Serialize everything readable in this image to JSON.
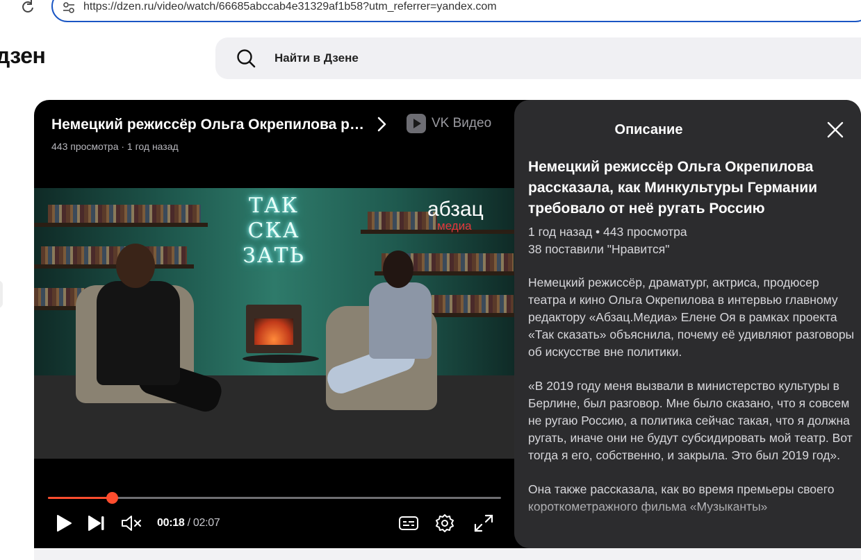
{
  "browser": {
    "url": "https://dzen.ru/video/watch/66685abccab4e31329af1b58?utm_referrer=yandex.com"
  },
  "header": {
    "logo": "дзен",
    "search_placeholder": "Найти в Дзене"
  },
  "player": {
    "title": "Немецкий режиссёр Ольга Окрепилова рассказала, как Минкультуры Германии требовало от неё ругать Россию",
    "meta": "443 просмотра · 1 год назад",
    "platform": "VK Видео",
    "video": {
      "neon_lines": [
        "ТАК",
        "СКА",
        "ЗАТЬ"
      ],
      "brand_main": "абзац",
      "brand_sub": "медиа"
    },
    "progress_fraction": 0.141,
    "time_current": "00:18",
    "time_separator": " / ",
    "time_total": "02:07",
    "accent_color": "#ff4d2e"
  },
  "description": {
    "heading": "Описание",
    "title": "Немецкий режиссёр Ольга Окрепилова рассказала, как Минкультуры Германии требовало от неё ругать Россию",
    "date_views": "1 год назад • 443 просмотра",
    "likes": "38 поставили \"Нравится\"",
    "paragraphs": [
      "Немецкий режиссёр, драматург, актриса, продюсер театра и кино Ольга Окрепилова в интервью главному редактору «Абзац.Медиа» Елене Оя в рамках проекта «Так сказать» объяснила, почему её удивляют разговоры об искусстве вне политики.",
      "«В 2019 году меня вызвали в министерство культуры в Берлине, был разговор. Мне было сказано, что я совсем не ругаю Россию, а политика сейчас такая, что я должна ругать, иначе они не будут субсидировать мой театр. Вот тогда я его, собственно, и закрыла. Это был 2019 год».",
      "Она также рассказала, как во время премьеры своего короткометражного фильма «Музыканты»"
    ]
  }
}
